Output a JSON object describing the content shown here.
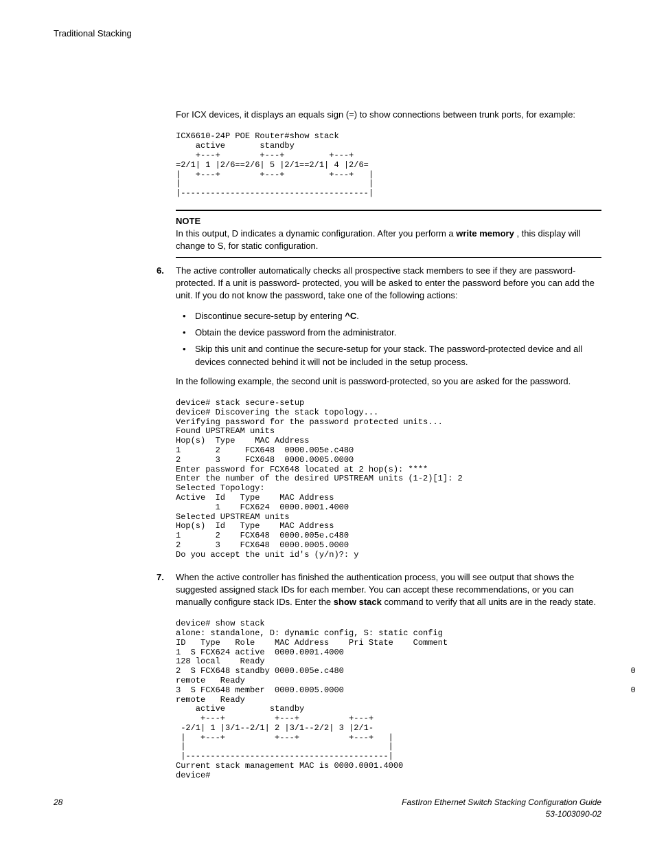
{
  "header": {
    "title": "Traditional Stacking"
  },
  "content": {
    "intro": "For ICX devices, it displays an equals sign (=) to show connections between trunk ports, for example:",
    "code1": "ICX6610-24P POE Router#show stack\n    active       standby\n    +---+        +---+         +---+\n=2/1| 1 |2/6==2/6| 5 |2/1==2/1| 4 |2/6=\n|   +---+        +---+         +---+   |\n|                                      |\n|--------------------------------------|",
    "note": {
      "label": "NOTE",
      "text_before": "In this output, D indicates a dynamic configuration. After you perform a ",
      "bold1": "write memory",
      "text_after": " , this display will change to S, for static configuration."
    },
    "step6": {
      "num": "6.",
      "para1": "The active controller automatically checks all prospective stack members to see if they are password-protected. If a unit is password- protected, you will be asked to enter the password before you can add the unit. If you do not know the password, take one of the following actions:",
      "bullets": {
        "b1_before": "Discontinue secure-setup by entering ",
        "b1_bold": "^C",
        "b1_after": ".",
        "b2": "Obtain the device password from the administrator.",
        "b3": "Skip this unit and continue the secure-setup for your stack. The password-protected device and all devices connected behind it will not be included in the setup process."
      },
      "para2": "In the following example, the second unit is password-protected, so you are asked for the password.",
      "code": "device# stack secure-setup\ndevice# Discovering the stack topology...\nVerifying password for the password protected units...\nFound UPSTREAM units\nHop(s)  Type    MAC Address\n1       2     FCX648  0000.005e.c480\n2       3     FCX648  0000.0005.0000\nEnter password for FCX648 located at 2 hop(s): ****\nEnter the number of the desired UPSTREAM units (1-2)[1]: 2\nSelected Topology:\nActive  Id   Type    MAC Address\n        1    FCX624  0000.0001.4000\nSelected UPSTREAM units\nHop(s)  Id   Type    MAC Address\n1       2    FCX648  0000.005e.c480\n2       3    FCX648  0000.0005.0000\nDo you accept the unit id's (y/n)?: y"
    },
    "step7": {
      "num": "7.",
      "para_before": "When the active controller has finished the authentication process, you will see output that shows the suggested assigned stack IDs for each member. You can accept these recommendations, or you can manually configure stack IDs. Enter the ",
      "para_bold": "show stack",
      "para_after": " command to verify that all units are in the ready state.",
      "code": "device# show stack\nalone: standalone, D: dynamic config, S: static config\nID   Type   Role    MAC Address    Pri State    Comment\n1  S FCX624 active  0000.0001.4000                                                          \n128 local    Ready\n2  S FCX648 standby 0000.005e.c480                                                          0\nremote   Ready\n3  S FCX648 member  0000.0005.0000                                                          0\nremote   Ready\n    active         standby\n     +---+          +---+          +---+\n -2/1| 1 |3/1--2/1| 2 |3/1--2/2| 3 |2/1-\n |   +---+          +---+          +---+   |\n |                                         |\n |-----------------------------------------|\nCurrent stack management MAC is 0000.0001.4000\ndevice#"
    }
  },
  "footer": {
    "page": "28",
    "title": "FastIron Ethernet Switch Stacking Configuration Guide",
    "docnum": "53-1003090-02"
  }
}
